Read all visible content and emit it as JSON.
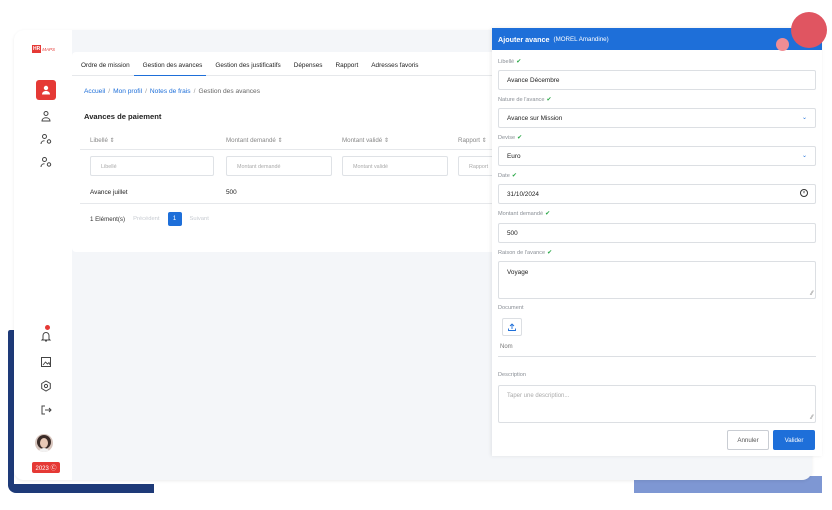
{
  "colors": {
    "accent": "#1e6fd9",
    "brand": "#e53935",
    "success": "#28a745"
  },
  "logo": {
    "hr": "HR",
    "maps": "MAPS"
  },
  "sidebar": {
    "icons": [
      "user-icon",
      "map-pin-user-icon",
      "user-settings-icon",
      "user-settings-icon-2"
    ],
    "bottom_icons": [
      "bell-icon",
      "image-icon",
      "gear-icon",
      "logout-icon"
    ],
    "year_badge": "2023 Ⓒ"
  },
  "tabs": [
    "Ordre de mission",
    "Gestion des avances",
    "Gestion des justificatifs",
    "Dépenses",
    "Rapport",
    "Adresses favoris"
  ],
  "breadcrumb": {
    "home": "Accueil",
    "profile": "Mon profil",
    "notes": "Notes de frais",
    "current": "Gestion des avances"
  },
  "section_title": "Avances de paiement",
  "table": {
    "headers": [
      "Libellé ⇕",
      "Montant demandé ⇕",
      "Montant validé ⇕",
      "Rapport ⇕"
    ],
    "filters": [
      "Libellé",
      "Montant demandé",
      "Montant validé",
      "Rapport"
    ],
    "rows": [
      {
        "libelle": "Avance juillet",
        "montant": "500"
      }
    ]
  },
  "pagination": {
    "count": "1 Elément(s)",
    "prev": "Précédent",
    "page": "1",
    "next": "Suivant"
  },
  "drawer": {
    "title": "Ajouter avance",
    "subtitle": "(MOREL Amandine)",
    "check": "✔",
    "fields": {
      "libelle_label": "Libellé",
      "libelle_value": "Avance Décembre",
      "nature_label": "Nature de l'avance",
      "nature_value": "Avance sur Mission",
      "devise_label": "Devise",
      "devise_value": "Euro",
      "date_label": "Date",
      "date_value": "31/10/2024",
      "montant_label": "Montant demandé",
      "montant_value": "500",
      "raison_label": "Raison de l'avance",
      "raison_value": "Voyage",
      "document_label": "Document",
      "nom_label": "Nom",
      "description_label": "Description",
      "description_placeholder": "Taper une description..."
    },
    "buttons": {
      "cancel": "Annuler",
      "submit": "Valider"
    }
  }
}
